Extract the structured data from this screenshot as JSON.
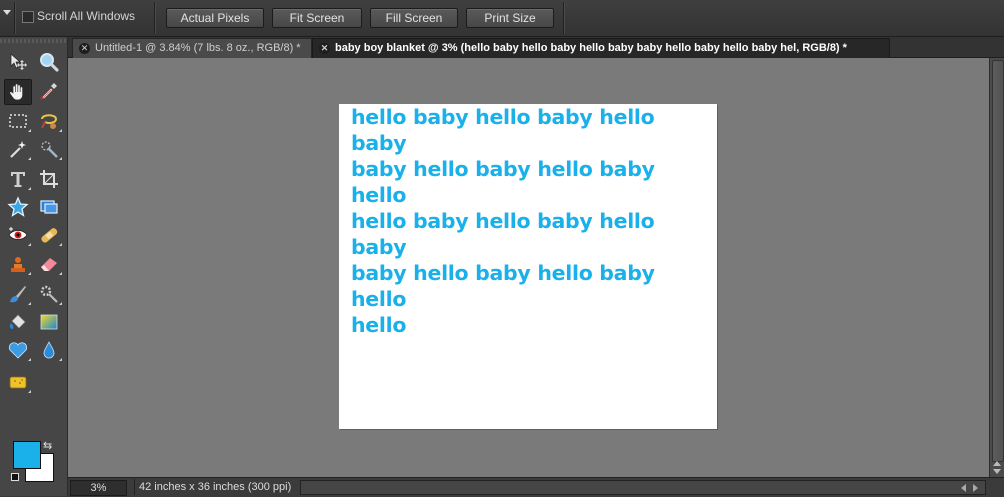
{
  "options_bar": {
    "scroll_all_windows_label": "Scroll All Windows",
    "scroll_all_windows_checked": false,
    "buttons": [
      "Actual Pixels",
      "Fit Screen",
      "Fill Screen",
      "Print Size"
    ]
  },
  "tabs": [
    {
      "label": "Untitled-1 @ 3.84% (7 lbs. 8 oz., RGB/8) *",
      "active": false
    },
    {
      "label": "baby boy blanket @ 3% (hello baby hello baby hello baby baby hello baby hello baby hel, RGB/8) *",
      "active": true
    }
  ],
  "tools": [
    "move-tool-icon",
    "zoom-tool-icon",
    "hand-tool-icon",
    "eyedropper-tool-icon",
    "marquee-tool-icon",
    "lasso-tool-icon",
    "magic-wand-tool-icon",
    "quick-selection-tool-icon",
    "type-tool-icon",
    "crop-tool-icon",
    "cookie-cutter-tool-icon",
    "straighten-tool-icon",
    "red-eye-tool-icon",
    "healing-brush-tool-icon",
    "clone-stamp-tool-icon",
    "eraser-tool-icon",
    "brush-tool-icon",
    "smart-brush-tool-icon",
    "paint-bucket-tool-icon",
    "gradient-tool-icon",
    "custom-shape-tool-icon",
    "blur-tool-icon",
    "sponge-tool-icon"
  ],
  "colors": {
    "foreground": "#1ab0ea",
    "background": "#ffffff",
    "text_color": "#1ab0ea"
  },
  "document": {
    "lines": [
      "hello baby hello baby hello baby",
      "baby hello baby hello baby hello",
      "hello baby hello baby hello baby",
      "baby hello baby hello baby hello",
      "hello"
    ]
  },
  "status": {
    "zoom": "3%",
    "dimensions": "42 inches x 36 inches (300 ppi)"
  }
}
